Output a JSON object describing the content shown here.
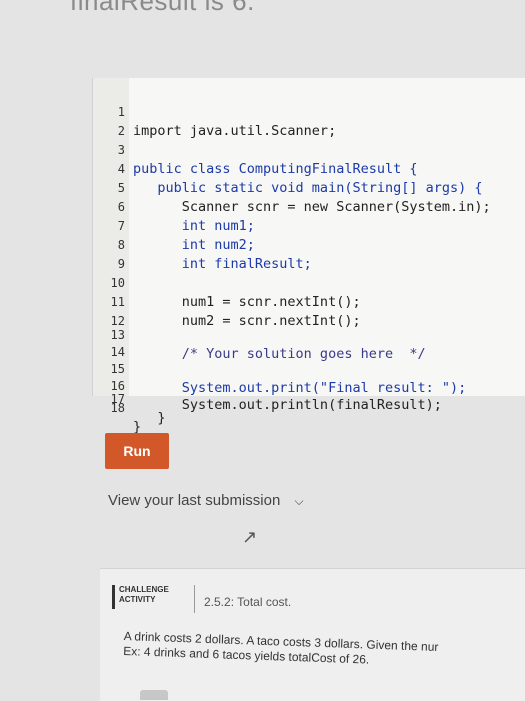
{
  "header": {
    "partial_text": "finalResult is 6."
  },
  "editor": {
    "lines": [
      {
        "num": "1",
        "code": "import java.util.Scanner;"
      },
      {
        "num": "2",
        "code": ""
      },
      {
        "num": "3",
        "code": "public class ComputingFinalResult {"
      },
      {
        "num": "4",
        "code": "   public static void main(String[] args) {"
      },
      {
        "num": "5",
        "code": "      Scanner scnr = new Scanner(System.in);"
      },
      {
        "num": "6",
        "code": "      int num1;"
      },
      {
        "num": "7",
        "code": "      int num2;"
      },
      {
        "num": "8",
        "code": "      int finalResult;"
      },
      {
        "num": "9",
        "code": ""
      },
      {
        "num": "10",
        "code": "      num1 = scnr.nextInt();"
      },
      {
        "num": "11",
        "code": "      num2 = scnr.nextInt();"
      },
      {
        "num": "12",
        "code": ""
      },
      {
        "num": "13",
        "code": "      /* Your solution goes here  */"
      },
      {
        "num": "14",
        "code": ""
      },
      {
        "num": "15",
        "code": "      System.out.print(\"Final result: \");"
      },
      {
        "num": "16",
        "code": "      System.out.println(finalResult);"
      },
      {
        "num": "17",
        "code": "   }"
      },
      {
        "num": "18",
        "code": "}"
      }
    ]
  },
  "run_button": {
    "label": "Run"
  },
  "submission": {
    "label": "View your last submission",
    "chevron": "chevron-down-icon"
  },
  "challenge": {
    "badge_line1": "CHALLENGE",
    "badge_line2": "ACTIVITY",
    "title": "2.5.2: Total cost.",
    "description": "A drink costs 2 dollars. A taco costs 3 dollars. Given the nur",
    "example": "Ex: 4 drinks and 6 tacos yields totalCost of 26."
  }
}
